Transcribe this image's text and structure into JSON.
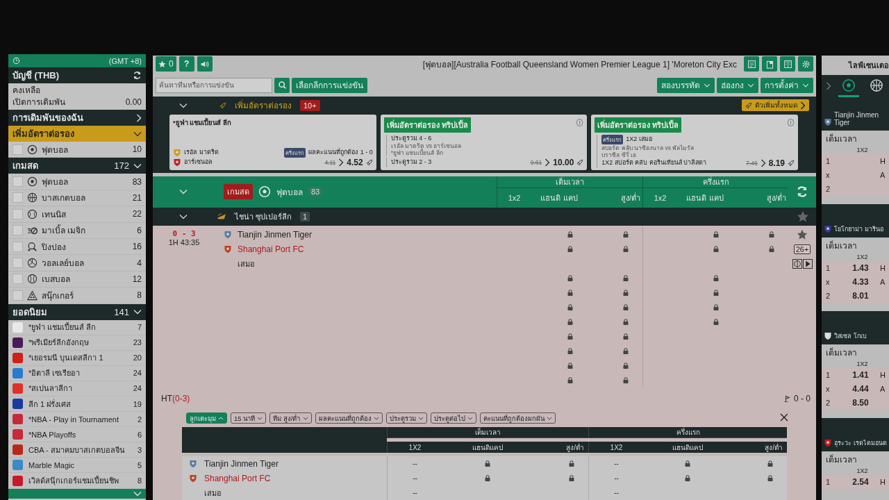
{
  "sidebar": {
    "timezone": "(GMT +8)",
    "account": {
      "title": "บัญชี (THB)",
      "rows": [
        {
          "label": "คงเหลือ"
        },
        {
          "label": "เปิดการเดิมพัน",
          "value": "0.00"
        }
      ]
    },
    "sections": [
      {
        "kind": "link",
        "title": "การเดิมพันของฉัน",
        "expanded": false
      },
      {
        "kind": "boost",
        "title": "เพิ่มอัตราต่อรอง",
        "expanded": true,
        "sports": [
          {
            "kind": "football",
            "label": "ฟุตบอล",
            "count": "10",
            "checked": false
          }
        ]
      },
      {
        "kind": "sports",
        "title": "เกมสด",
        "count": "172",
        "expanded": true,
        "sports": [
          {
            "kind": "football",
            "label": "ฟุตบอล",
            "count": "83",
            "checked": false
          },
          {
            "kind": "basketball",
            "label": "บาสเกตบอล",
            "count": "21",
            "checked": false
          },
          {
            "kind": "tennis",
            "label": "เทนนิส",
            "count": "22",
            "checked": false
          },
          {
            "kind": "marble",
            "label": "มาเบิ้ล เมจิก",
            "count": "6",
            "checked": false
          },
          {
            "kind": "pingpong",
            "label": "ปิงปอง",
            "count": "16",
            "checked": false
          },
          {
            "kind": "volleyball",
            "label": "วอลเลย์บอล",
            "count": "4",
            "checked": false
          },
          {
            "kind": "baseball",
            "label": "เบสบอล",
            "count": "12",
            "checked": false
          },
          {
            "kind": "snooker",
            "label": "สนุ๊กเกอร์",
            "count": "8",
            "checked": false
          }
        ]
      },
      {
        "kind": "popular",
        "title": "ยอดนิยม",
        "count": "141",
        "expanded": true,
        "leagues": [
          {
            "label": "*ยูฟ่า แชมเปี้ยนส์ ลีก",
            "count": "7",
            "color": "#e8e8e8"
          },
          {
            "label": "*พรีเมียร์ลีกอังกฤษ",
            "count": "23",
            "color": "#4a1a5a"
          },
          {
            "label": "*เยอรมนี บุนเดสลีกา 1",
            "count": "20",
            "color": "#d0201a"
          },
          {
            "label": "*อิตาลี เซเรียอา",
            "count": "24",
            "color": "#2a7ad0"
          },
          {
            "label": "*สเปนลาลีกา",
            "count": "24",
            "color": "#e0302a"
          },
          {
            "label": "ลีก 1 ฝรั่งเศส",
            "count": "19",
            "color": "#1a3aa0"
          },
          {
            "label": "*NBA - Play in Tournament",
            "count": "2",
            "color": "#c8283a"
          },
          {
            "label": "*NBA Playoffs",
            "count": "6",
            "color": "#c8283a"
          },
          {
            "label": "CBA - สมาคมบาสเกตบอลจีน",
            "count": "3",
            "color": "#b8281a"
          },
          {
            "label": "Marble Magic",
            "count": "5",
            "color": "#3a8ac8"
          },
          {
            "label": "เวิลด์สนุ๊กเกอร์แชมเปี้ยนชิพ",
            "count": "8",
            "color": "#c81a2a"
          }
        ]
      },
      {
        "kind": "more",
        "expanded": true
      }
    ]
  },
  "toolbar": {
    "favourites": "0",
    "help": "?",
    "ticker": "[ฟุตบอล][Australia Football Queensland Women Premier League 1] 'Moreton City Exc"
  },
  "search": {
    "placeholder": "ค้นหาทีมหรือการแข่งขัน",
    "league_button": "เลือกลีกการแข่งขัน",
    "dropdowns": [
      "สองบรรทัด",
      "ฮ่องกง",
      "การตั้งค่า"
    ]
  },
  "boost": {
    "title": "เพิ่มอัตราต่อรอง",
    "badge": "10+",
    "all_button": "ตัวเพิ่มทั้งหมด",
    "cards": [
      {
        "kind": "single",
        "league": "*ยูฟ่า แชมเปี้ยนส์ ลีก",
        "home": "เรอัล มาดริด",
        "away": "อาร์เซนอล",
        "tag": "ครึ่งแรก",
        "market": "ผลคะแนนที่ถูกต้อง",
        "pick": "1 - 0",
        "old_odds": "4.11",
        "new_odds": "4.52"
      },
      {
        "kind": "triple",
        "title": "เพิ่มอัตราต่อรอง ทริปเปิ้ล",
        "legs": [
          {
            "market": "ประตูรวม 4 - 6",
            "match": "เรอัล มาดริด vs อาร์เซนอล",
            "league": "*ยูฟ่า แชมเปี้ยนส์ ลีก"
          },
          {
            "market": "ประตูรวม 2 - 3"
          }
        ],
        "old_odds": "9.61",
        "new_odds": "10.00"
      },
      {
        "kind": "triple",
        "title": "เพิ่มอัตราต่อรอง ทริปเปิ้ล",
        "legs": [
          {
            "tag": "ครึ่งแรก",
            "market": "1X2 เสมอ",
            "match": "สปอร์ต คลับ นาซิองนาล vs พัลไมรัส",
            "league": "บราซิล ซีรี่ เอ"
          },
          {
            "market": "1X2 สปอร์ต คลับ คอรินเทียนส์ ปาลิสตา"
          }
        ],
        "old_odds": "7.46",
        "new_odds": "8.19"
      }
    ]
  },
  "live": {
    "badge": "เกมสด",
    "sport": "ฟุตบอล",
    "count": "83",
    "groups": [
      "เต็มเวลา",
      "ครึ่งแรก"
    ],
    "columns": [
      "1x2",
      "แฮนดิ แคป",
      "สูง/ต่ำ",
      "1x2",
      "แฮนดิ แคป",
      "สูง/ต่ำ"
    ],
    "league": {
      "name": "ไชน่า ซุปเปอร์ลีก",
      "count": "1"
    },
    "match": {
      "score": "0 - 3",
      "clock": "1H 43:35",
      "teams": [
        {
          "name": "Tianjin Jinmen Tiger",
          "favourite": false
        },
        {
          "name": "Shanghai Port FC",
          "favourite": true
        }
      ],
      "draw": "เสมอ",
      "more": "26+",
      "lines": [
        {
          "locks": [
            false,
            true,
            true,
            false,
            true,
            true
          ]
        },
        {
          "locks": [
            false,
            true,
            true,
            false,
            true,
            true
          ]
        },
        {
          "locks": [
            false,
            false,
            false,
            false,
            false,
            false
          ]
        },
        {
          "locks": [
            false,
            true,
            true,
            false,
            true,
            false
          ]
        },
        {
          "locks": [
            false,
            true,
            true,
            false,
            true,
            false
          ]
        },
        {
          "locks": [
            false,
            true,
            true,
            false,
            true,
            false
          ]
        },
        {
          "locks": [
            false,
            true,
            true,
            false,
            true,
            false
          ]
        },
        {
          "locks": [
            false,
            true,
            true,
            false,
            false,
            false
          ]
        },
        {
          "locks": [
            false,
            true,
            true,
            false,
            false,
            false
          ]
        },
        {
          "locks": [
            false,
            true,
            true,
            false,
            false,
            false
          ]
        },
        {
          "locks": [
            false,
            true,
            true,
            false,
            false,
            false
          ]
        }
      ]
    },
    "halftime": {
      "label": "HT",
      "score": "(0-3)",
      "corners": "0 - 0"
    },
    "chips": [
      {
        "label": "ลูกเตะมุม",
        "selected": true
      },
      {
        "label": "15 นาที",
        "selected": false
      },
      {
        "label": "ทีม สูง/ต่ำ",
        "selected": false
      },
      {
        "label": "ผลคะแนนที่ถูกต้อง",
        "selected": false
      },
      {
        "label": "ประตูรวม",
        "selected": false
      },
      {
        "label": "ประตูต่อไป",
        "selected": false
      },
      {
        "label": "คะแนนที่ถูกต้องผกผัน",
        "selected": false
      }
    ],
    "sub_table": {
      "groups": [
        "เต็มเวลา",
        "ครึ่งแรก"
      ],
      "columns": [
        "1X2",
        "แฮนดิแคป",
        "สูง/ต่ำ",
        "1X2",
        "แฮนดิแคป",
        "สูง/ต่ำ"
      ],
      "rows": [
        {
          "team": "Tianjin Jinmen Tiger",
          "favourite": false,
          "ft_1x2": "--",
          "ht_1x2": "--",
          "locks": [
            true,
            true,
            true,
            true
          ]
        },
        {
          "team": "Shanghai Port FC",
          "favourite": true,
          "ft_1x2": "--",
          "ht_1x2": "--",
          "locks": [
            true,
            true,
            true,
            true
          ]
        },
        {
          "team": "เสมอ",
          "favourite": false,
          "ft_1x2": "--",
          "ht_1x2": "--",
          "locks": [
            false,
            false,
            false,
            false
          ]
        }
      ]
    }
  },
  "live_centre": {
    "title": "ไลฟ์เซนเตอ",
    "tabs": [
      {
        "kind": "football",
        "selected": true
      },
      {
        "kind": "basketball",
        "selected": false
      }
    ],
    "matches": [
      {
        "team": "Tianjin Jinmen Tiger",
        "period": "เต็มเวลา",
        "market": "1X2",
        "rows": [
          {
            "label": "1",
            "side": "H"
          },
          {
            "label": "x",
            "side": "A"
          },
          {
            "label": "2"
          }
        ]
      },
      {
        "team": "โยโกฮาม่า มารินอ",
        "period": "เต็มเวลา",
        "market": "1X2",
        "rows": [
          {
            "label": "1",
            "odds": "1.43",
            "side": "H"
          },
          {
            "label": "x",
            "odds": "4.33",
            "side": "A"
          },
          {
            "label": "2",
            "odds": "8.01"
          }
        ]
      },
      {
        "team": "วิสเซล โกเบ",
        "period": "เต็มเวลา",
        "market": "1X2",
        "rows": [
          {
            "label": "1",
            "odds": "1.41",
            "side": "H"
          },
          {
            "label": "x",
            "odds": "4.44",
            "side": "A"
          },
          {
            "label": "2",
            "odds": "8.50"
          }
        ]
      },
      {
        "team": "อุระวะ เรดไดมอนด",
        "period": "เต็มเวลา",
        "market": "1X2",
        "rows": [
          {
            "label": "1",
            "odds": "2.54",
            "side": "H"
          }
        ]
      }
    ]
  }
}
